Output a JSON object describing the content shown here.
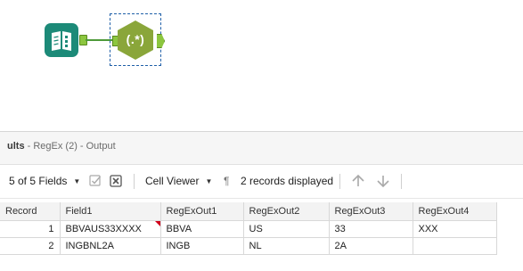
{
  "results": {
    "title_prefix": "ults",
    "title_suffix": " - RegEx (2) - Output"
  },
  "toolbar": {
    "fields_selector": "5 of 5 Fields",
    "viewer_selector": "Cell Viewer",
    "pilcrow": "¶",
    "records_status": "2 records displayed"
  },
  "table": {
    "headers": [
      "Record",
      "Field1",
      "RegExOut1",
      "RegExOut2",
      "RegExOut3",
      "RegExOut4"
    ],
    "rows": [
      [
        "1",
        "BBVAUS33XXXX",
        "BBVA",
        "US",
        "33",
        "XXX"
      ],
      [
        "2",
        "INGBNL2A",
        "INGB",
        "NL",
        "2A",
        ""
      ]
    ]
  },
  "canvas": {
    "regex_tool_label": "(.*)"
  },
  "colors": {
    "input_tool": "#1c8a78",
    "regex_tool": "#8aa63a",
    "anchor": "#8cc63f",
    "connector": "#4e9a3a",
    "selection_border": "#1f5fa8",
    "truncation_flag": "#d0021b"
  },
  "icons": {
    "input_tool": "book-icon",
    "regex_tool": "regex-hexagon-icon",
    "check": "checkbox-icon",
    "clear": "clear-x-icon",
    "up": "arrow-up-icon",
    "down": "arrow-down-icon"
  }
}
